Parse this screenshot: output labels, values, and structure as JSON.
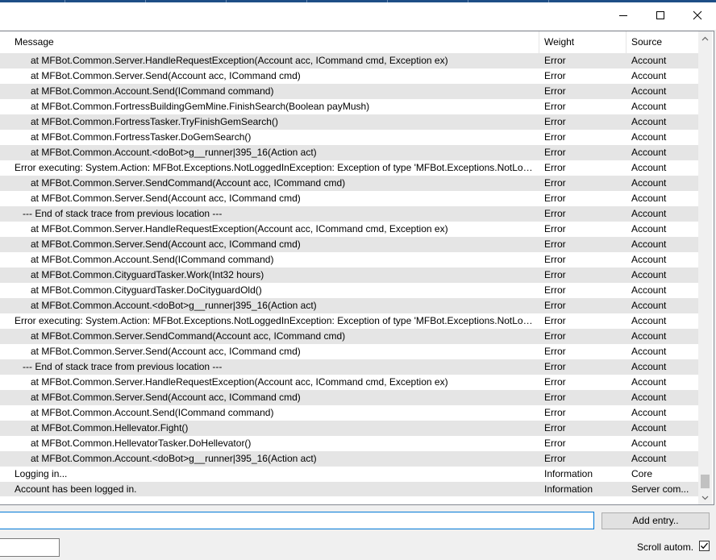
{
  "window_controls": {
    "minimize_icon": "minimize-icon",
    "maximize_icon": "maximize-icon",
    "close_icon": "close-icon"
  },
  "columns": {
    "message": "Message",
    "weight": "Weight",
    "source": "Source"
  },
  "rows": [
    {
      "message": "      at MFBot.Common.Server.HandleRequestException(Account acc, ICommand cmd, Exception ex)",
      "weight": "Error",
      "source": "Account"
    },
    {
      "message": "      at MFBot.Common.Server.Send(Account acc, ICommand cmd)",
      "weight": "Error",
      "source": "Account"
    },
    {
      "message": "      at MFBot.Common.Account.Send(ICommand command)",
      "weight": "Error",
      "source": "Account"
    },
    {
      "message": "      at MFBot.Common.FortressBuildingGemMine.FinishSearch(Boolean payMush)",
      "weight": "Error",
      "source": "Account"
    },
    {
      "message": "      at MFBot.Common.FortressTasker.TryFinishGemSearch()",
      "weight": "Error",
      "source": "Account"
    },
    {
      "message": "      at MFBot.Common.FortressTasker.DoGemSearch()",
      "weight": "Error",
      "source": "Account"
    },
    {
      "message": "      at MFBot.Common.Account.<doBot>g__runner|395_16(Action act)",
      "weight": "Error",
      "source": "Account"
    },
    {
      "message": "Error executing: System.Action: MFBot.Exceptions.NotLoggedInException: Exception of type 'MFBot.Exceptions.NotLog...",
      "weight": "Error",
      "source": "Account"
    },
    {
      "message": "      at MFBot.Common.Server.SendCommand(Account acc, ICommand cmd)",
      "weight": "Error",
      "source": "Account"
    },
    {
      "message": "      at MFBot.Common.Server.Send(Account acc, ICommand cmd)",
      "weight": "Error",
      "source": "Account"
    },
    {
      "message": "   --- End of stack trace from previous location ---",
      "weight": "Error",
      "source": "Account"
    },
    {
      "message": "      at MFBot.Common.Server.HandleRequestException(Account acc, ICommand cmd, Exception ex)",
      "weight": "Error",
      "source": "Account"
    },
    {
      "message": "      at MFBot.Common.Server.Send(Account acc, ICommand cmd)",
      "weight": "Error",
      "source": "Account"
    },
    {
      "message": "      at MFBot.Common.Account.Send(ICommand command)",
      "weight": "Error",
      "source": "Account"
    },
    {
      "message": "      at MFBot.Common.CityguardTasker.Work(Int32 hours)",
      "weight": "Error",
      "source": "Account"
    },
    {
      "message": "      at MFBot.Common.CityguardTasker.DoCityguardOld()",
      "weight": "Error",
      "source": "Account"
    },
    {
      "message": "      at MFBot.Common.Account.<doBot>g__runner|395_16(Action act)",
      "weight": "Error",
      "source": "Account"
    },
    {
      "message": "Error executing: System.Action: MFBot.Exceptions.NotLoggedInException: Exception of type 'MFBot.Exceptions.NotLog...",
      "weight": "Error",
      "source": "Account"
    },
    {
      "message": "      at MFBot.Common.Server.SendCommand(Account acc, ICommand cmd)",
      "weight": "Error",
      "source": "Account"
    },
    {
      "message": "      at MFBot.Common.Server.Send(Account acc, ICommand cmd)",
      "weight": "Error",
      "source": "Account"
    },
    {
      "message": "   --- End of stack trace from previous location ---",
      "weight": "Error",
      "source": "Account"
    },
    {
      "message": "      at MFBot.Common.Server.HandleRequestException(Account acc, ICommand cmd, Exception ex)",
      "weight": "Error",
      "source": "Account"
    },
    {
      "message": "      at MFBot.Common.Server.Send(Account acc, ICommand cmd)",
      "weight": "Error",
      "source": "Account"
    },
    {
      "message": "      at MFBot.Common.Account.Send(ICommand command)",
      "weight": "Error",
      "source": "Account"
    },
    {
      "message": "      at MFBot.Common.Hellevator.Fight()",
      "weight": "Error",
      "source": "Account"
    },
    {
      "message": "      at MFBot.Common.HellevatorTasker.DoHellevator()",
      "weight": "Error",
      "source": "Account"
    },
    {
      "message": "      at MFBot.Common.Account.<doBot>g__runner|395_16(Action act)",
      "weight": "Error",
      "source": "Account"
    },
    {
      "message": "Logging in...",
      "weight": "Information",
      "source": "Core"
    },
    {
      "message": "Account has been logged in.",
      "weight": "Information",
      "source": "Server com..."
    }
  ],
  "entry_input": {
    "value": ""
  },
  "add_entry_button": "Add entry..",
  "small_input": {
    "value": ""
  },
  "scroll_autom": {
    "label": "Scroll autom.",
    "checked": true
  },
  "scrollbar": {
    "position": 1.0
  },
  "colors": {
    "accent": "#0078d7",
    "row_alt": "#e5e5e5",
    "title_accent": "#1e4e86"
  }
}
